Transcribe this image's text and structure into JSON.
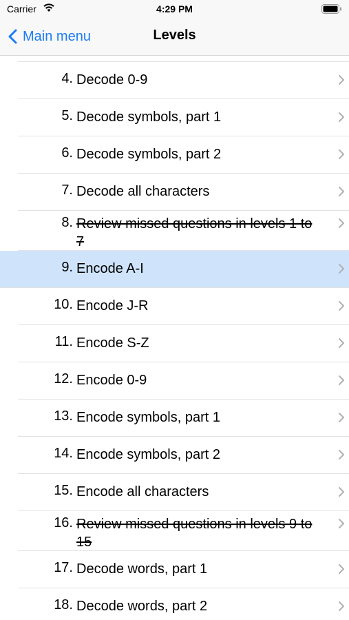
{
  "status_bar": {
    "carrier": "Carrier",
    "time": "4:29 PM"
  },
  "nav": {
    "back_label": "Main menu",
    "title": "Levels"
  },
  "colors": {
    "accent": "#1a7cf5",
    "selected_row": "#cfe4fb"
  },
  "levels": [
    {
      "num": "4.",
      "label": "Decode 0-9"
    },
    {
      "num": "5.",
      "label": "Decode symbols, part 1"
    },
    {
      "num": "6.",
      "label": "Decode symbols, part 2"
    },
    {
      "num": "7.",
      "label": "Decode all characters"
    },
    {
      "num": "8.",
      "label": "Review missed questions in levels 1 to 7",
      "strikethrough": true
    },
    {
      "num": "9.",
      "label": "Encode A-I",
      "selected": true
    },
    {
      "num": "10.",
      "label": "Encode J-R"
    },
    {
      "num": "11.",
      "label": "Encode S-Z"
    },
    {
      "num": "12.",
      "label": "Encode 0-9"
    },
    {
      "num": "13.",
      "label": "Encode symbols, part 1"
    },
    {
      "num": "14.",
      "label": "Encode symbols, part 2"
    },
    {
      "num": "15.",
      "label": "Encode all characters"
    },
    {
      "num": "16.",
      "label": "Review missed questions in levels 9 to 15",
      "strikethrough": true
    },
    {
      "num": "17.",
      "label": "Decode words, part 1"
    },
    {
      "num": "18.",
      "label": "Decode words, part 2"
    }
  ]
}
